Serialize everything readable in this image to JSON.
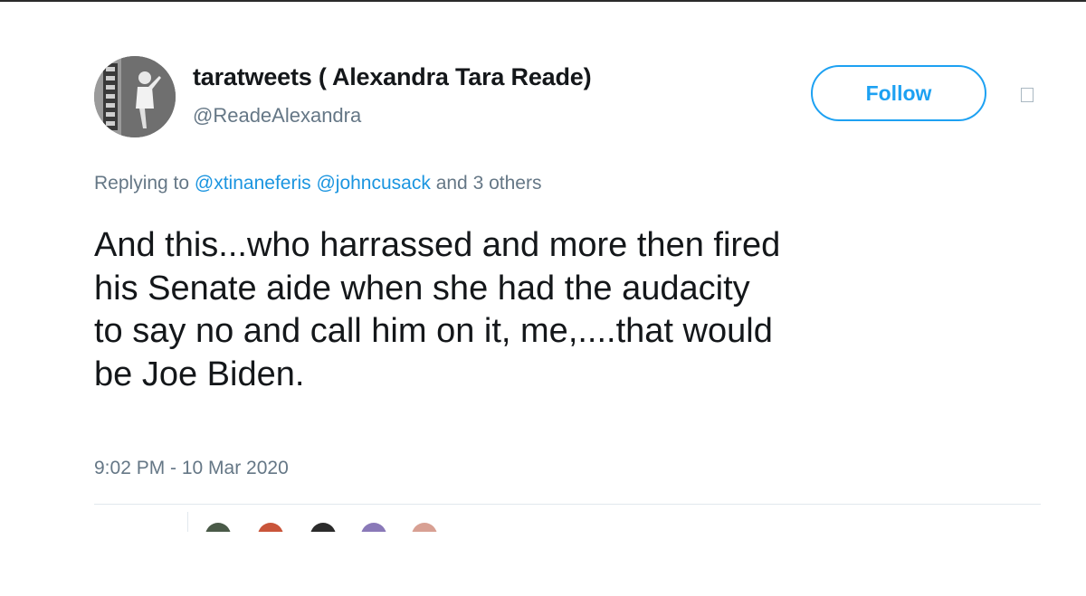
{
  "tweet": {
    "author": {
      "display_name": "taratweets ( Alexandra Tara Reade)",
      "handle": "@ReadeAlexandra",
      "avatar_icon": "profile-photo"
    },
    "follow_button_label": "Follow",
    "menu_icon": "caret-menu-icon",
    "replying": {
      "prefix": "Replying to",
      "mentions": [
        "@xtinaneferis",
        "@johncusack"
      ],
      "suffix": "and 3 others"
    },
    "text_lines": [
      "And this...who harrassed and more then fired",
      "his Senate aide when she had the audacity",
      "to say no and call him on it, me,....that would",
      "be Joe Biden."
    ],
    "timestamp": "9:02 PM - 10 Mar 2020"
  },
  "colors": {
    "accent": "#1da1f2",
    "mention": "#1b95e0",
    "text": "#14171a",
    "muted": "#657786",
    "divider": "#e1e8ed"
  },
  "liker_avatar_colors": [
    "#4a5a48",
    "#c9553a",
    "#2b2b2b",
    "#8a79b8",
    "#d8a093"
  ]
}
